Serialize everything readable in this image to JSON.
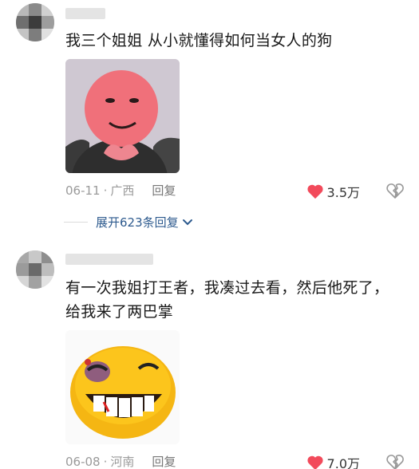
{
  "comments": [
    {
      "text": "我三个姐姐 从小就懂得如何当女人的狗",
      "date": "06-11",
      "location": "广西",
      "reply_label": "回复",
      "likes": "3.5万",
      "sticker_icon": "pink-face-sticker"
    },
    {
      "text": "有一次我姐打王者，我凑过去看，然后他死了，给我来了两巴掌",
      "date": "06-08",
      "location": "河南",
      "reply_label": "回复",
      "likes": "7.0万",
      "sticker_icon": "yellow-grin-sticker"
    }
  ],
  "expand_replies": {
    "label": "展开623条回复"
  },
  "meta_separator": "·",
  "colors": {
    "like_red": "#f24a5b",
    "link_blue": "#2d5a8e",
    "meta_gray": "#9a9a9a"
  }
}
